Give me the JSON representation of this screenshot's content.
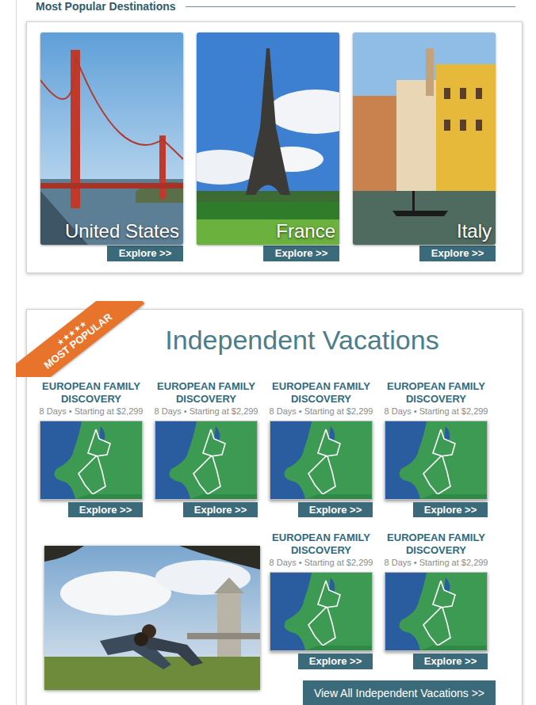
{
  "destinations": {
    "title": "Most Popular Destinations",
    "items": [
      {
        "name": "United States",
        "button": "Explore >>"
      },
      {
        "name": "France",
        "button": "Explore >>"
      },
      {
        "name": "Italy",
        "button": "Explore >>"
      }
    ]
  },
  "vacations": {
    "badge": {
      "stars": "★★★★★",
      "label": "MOST POPULAR"
    },
    "title": "Independent Vacations",
    "tours": [
      {
        "title": "EUROPEAN FAMILY DISCOVERY",
        "days": "8 Days",
        "separator": "•",
        "price": "Starting at $2,299",
        "button": "Explore >>"
      },
      {
        "title": "EUROPEAN FAMILY DISCOVERY",
        "days": "8 Days",
        "separator": "•",
        "price": "Starting at $2,299",
        "button": "Explore >>"
      },
      {
        "title": "EUROPEAN FAMILY DISCOVERY",
        "days": "8 Days",
        "separator": "•",
        "price": "Starting at $2,299",
        "button": "Explore >>"
      },
      {
        "title": "EUROPEAN FAMILY DISCOVERY",
        "days": "8 Days",
        "separator": "•",
        "price": "Starting at $2,299",
        "button": "Explore >>"
      },
      {
        "title": "EUROPEAN FAMILY DISCOVERY",
        "days": "8 Days",
        "separator": "•",
        "price": "Starting at $2,299",
        "button": "Explore >>"
      },
      {
        "title": "EUROPEAN FAMILY DISCOVERY",
        "days": "8 Days",
        "separator": "•",
        "price": "Starting at $2,299",
        "button": "Explore >>"
      }
    ],
    "view_all": "View All Independent Vacations >>"
  }
}
